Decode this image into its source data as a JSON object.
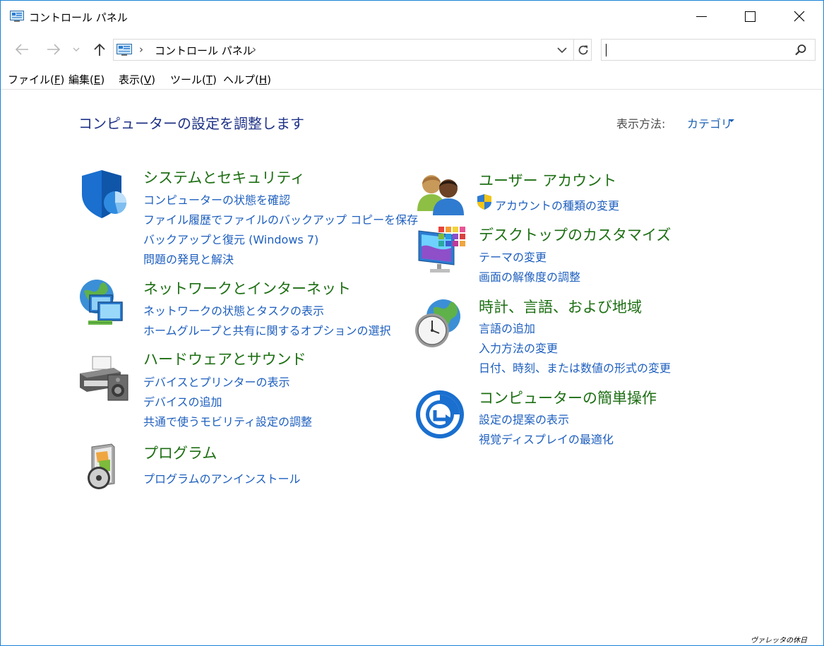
{
  "window": {
    "title": "コントロール パネル",
    "accent": "#1883d7"
  },
  "nav": {
    "back_icon": "back-arrow-icon",
    "forward_icon": "forward-arrow-icon",
    "recent_icon": "chevron-down-icon",
    "up_icon": "up-arrow-icon",
    "breadcrumb_sep": "›",
    "breadcrumb": "コントロール パネル",
    "search_placeholder": ""
  },
  "menu": {
    "file": "ファイル(",
    "file_key": "F",
    "edit": "編集(",
    "edit_key": "E",
    "view": "表示(",
    "view_key": "V",
    "tools": "ツール(",
    "tools_key": "T",
    "help": "ヘルプ(",
    "help_key": "H",
    "close_paren": ")"
  },
  "main": {
    "title": "コンピューターの設定を調整します",
    "view_by_label": "表示方法:",
    "view_by_value": "カテゴリ"
  },
  "categories": {
    "system": {
      "title": "システムとセキュリティ",
      "links": [
        "コンピューターの状態を確認",
        "ファイル履歴でファイルのバックアップ コピーを保存",
        "バックアップと復元 (Windows 7)",
        "問題の発見と解決"
      ]
    },
    "network": {
      "title": "ネットワークとインターネット",
      "links": [
        "ネットワークの状態とタスクの表示",
        "ホームグループと共有に関するオプションの選択"
      ]
    },
    "hardware": {
      "title": "ハードウェアとサウンド",
      "links": [
        "デバイスとプリンターの表示",
        "デバイスの追加",
        "共通で使うモビリティ設定の調整"
      ]
    },
    "programs": {
      "title": "プログラム",
      "links": [
        "プログラムのアンインストール"
      ]
    },
    "users": {
      "title": "ユーザー アカウント",
      "links": [
        "アカウントの種類の変更"
      ]
    },
    "appearance": {
      "title": "デスクトップのカスタマイズ",
      "links": [
        "テーマの変更",
        "画面の解像度の調整"
      ]
    },
    "clock": {
      "title": "時計、言語、および地域",
      "links": [
        "言語の追加",
        "入力方法の変更",
        "日付、時刻、または数値の形式の変更"
      ]
    },
    "ease": {
      "title": "コンピューターの簡単操作",
      "links": [
        "設定の提案の表示",
        "視覚ディスプレイの最適化"
      ]
    }
  },
  "watermark": "ヴァレッタの休日",
  "colors": {
    "category_title": "#1d6f13",
    "link": "#1e5fbf",
    "page_title": "#1e3287"
  }
}
